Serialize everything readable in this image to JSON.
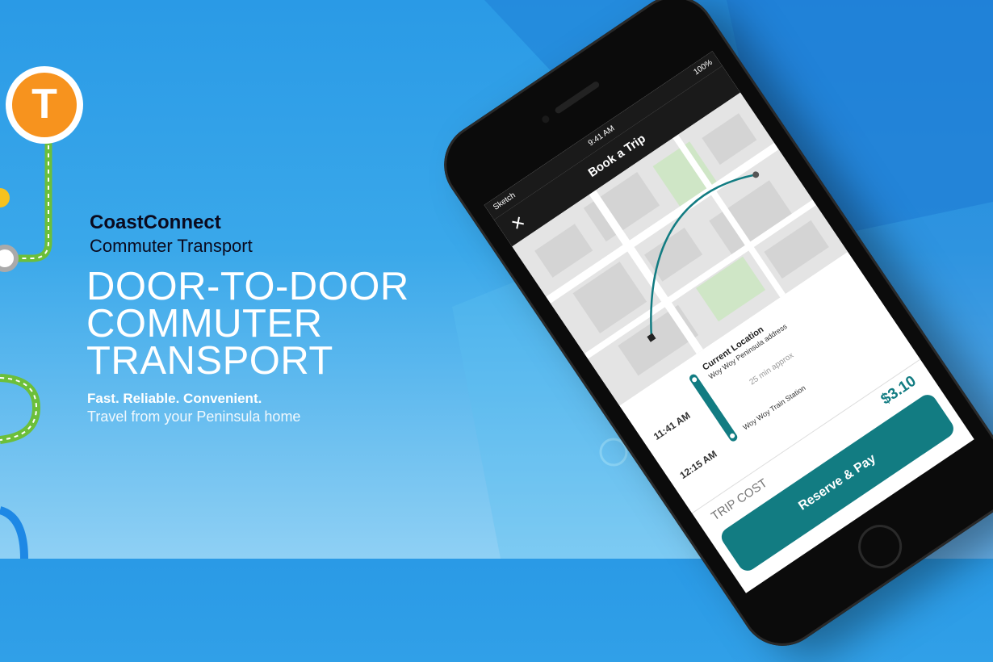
{
  "brand": {
    "name": "CoastConnect",
    "subtitle": "Commuter Transport"
  },
  "hero": {
    "headline_line1": "DOOR-TO-DOOR",
    "headline_line2": "COMMUTER",
    "headline_line3": "TRANSPORT",
    "tagline": "Fast. Reliable. Convenient.",
    "subtagline": "Travel from your Peninsula home"
  },
  "decor": {
    "transit_badge_letter": "T"
  },
  "phone": {
    "status": {
      "carrier": "Sketch",
      "time": "9:41 AM",
      "battery": "100%"
    },
    "nav": {
      "title": "Book a Trip",
      "close_icon": "✕"
    },
    "trip": {
      "start_time": "11:41 AM",
      "start_title": "Current Location",
      "start_sub": "Woy Woy Peninsula address",
      "duration": "25 min approx",
      "end_time": "12:15 AM",
      "end_title": "Woy Woy Train Station"
    },
    "cost": {
      "label": "TRIP COST",
      "value": "$3.10"
    },
    "reserve_label": "Reserve & Pay"
  },
  "colors": {
    "accent_teal": "#127c82",
    "transit_orange": "#f7931e",
    "line_green": "#6cbf3a"
  }
}
